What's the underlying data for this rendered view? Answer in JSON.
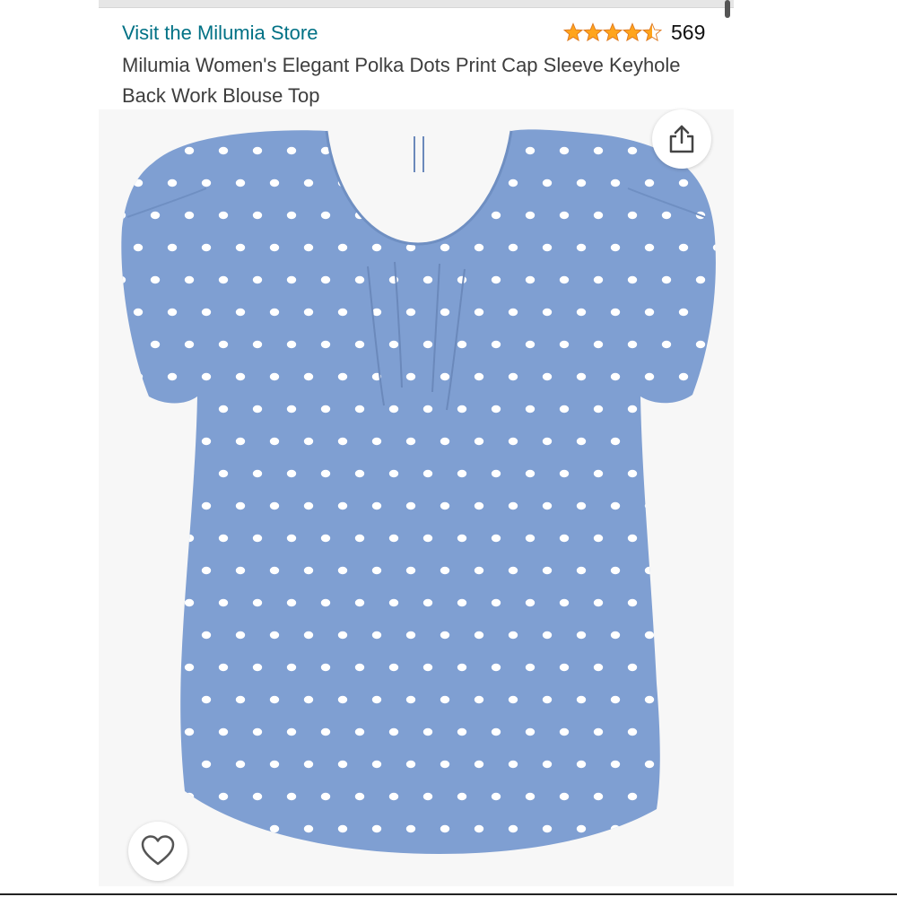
{
  "store": {
    "link_label": "Visit the Milumia Store",
    "link_color": "#007185"
  },
  "rating": {
    "stars": 4.5,
    "max_stars": 5,
    "count": "569",
    "star_color": "#FFA41C"
  },
  "product": {
    "title": "Milumia Women's Elegant Polka Dots Print Cap Sleeve Keyhole Back Work Blouse Top",
    "image": {
      "subject": "blouse",
      "fabric_color": "#7f9fd2",
      "dot_color": "#ffffff"
    }
  },
  "actions": {
    "share_icon": "share-icon",
    "wishlist_icon": "heart-icon"
  }
}
